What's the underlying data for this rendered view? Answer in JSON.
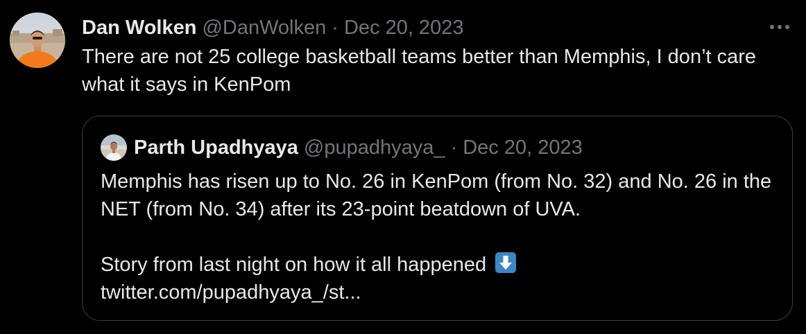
{
  "tweet": {
    "author_name": "Dan Wolken",
    "handle": "@DanWolken",
    "separator": "·",
    "date": "Dec 20, 2023",
    "text": "There are not 25 college basketball teams better than Memphis, I don’t care what it says in KenPom",
    "more_icon": "more-horizontal-icon"
  },
  "quote": {
    "author_name": "Parth Upadhyaya",
    "handle": "@pupadhyaya_",
    "separator": "·",
    "date": "Dec 20, 2023",
    "paragraph1": "Memphis has risen up to No. 26 in KenPom (from No. 32) and No. 26 in the NET (from No. 34) after its 23-point beatdown of UVA.",
    "paragraph2": "Story from last night on how it all happened",
    "emoji": "down-arrow-emoji-icon",
    "link": "twitter.com/pupadhyaya_/st..."
  },
  "colors": {
    "background": "#000000",
    "primary_text": "#e7e9ea",
    "secondary_text": "#71767b",
    "quote_border": "#3b4046",
    "emoji_blue": "#3b88c3"
  }
}
